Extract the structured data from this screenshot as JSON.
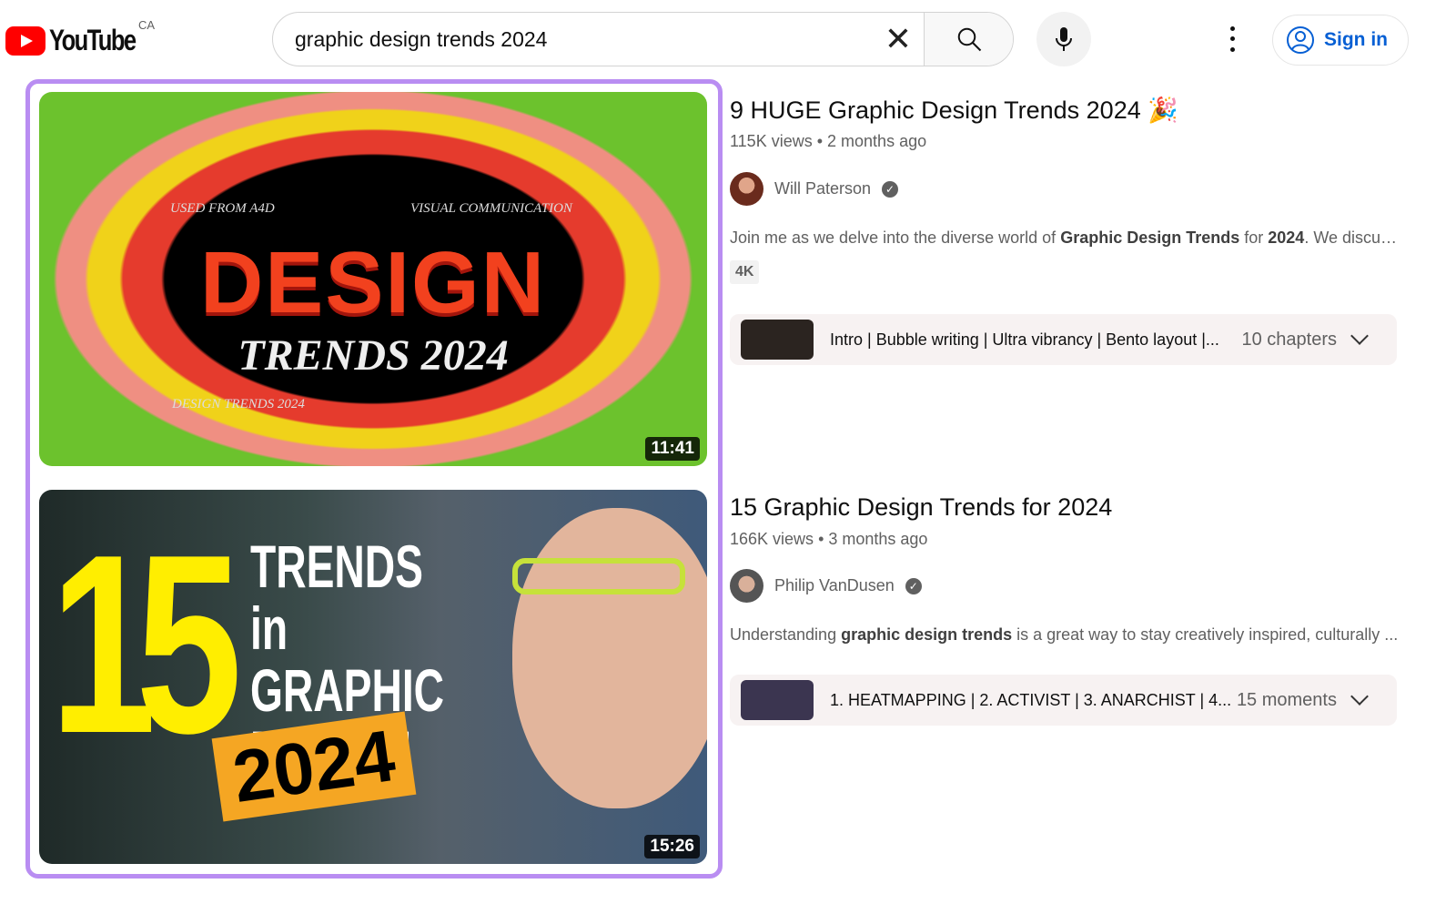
{
  "header": {
    "logo_text": "YouTube",
    "country": "CA",
    "search_value": "graphic design trends 2024",
    "sign_in": "Sign in"
  },
  "colors": {
    "brand": "#ff0000",
    "link": "#065fd4",
    "highlight": "#b98df2"
  },
  "results": [
    {
      "title": "9 HUGE Graphic Design Trends 2024",
      "emoji": "🎉",
      "views": "115K views",
      "age": "2 months ago",
      "channel": "Will Paterson",
      "desc_pre": "Join me as we delve into the diverse world of ",
      "desc_bold": "Graphic Design Trends",
      "desc_mid": " for ",
      "desc_bold2": "2024",
      "desc_post": ". We discuss...",
      "badge": "4K",
      "chapters_text": "Intro | Bubble writing | Ultra vibrancy | Bento layout |...",
      "chapters_count": "10 chapters",
      "duration": "11:41",
      "thumb": {
        "big": "DESIGN",
        "sub": "TRENDS 2024",
        "tl": "USED FROM A4D",
        "tr": "VISUAL COMMUNICATION",
        "bl": "DESIGN TRENDS 2024"
      }
    },
    {
      "title": "15 Graphic Design Trends for 2024",
      "views": "166K views",
      "age": "3 months ago",
      "channel": "Philip VanDusen",
      "desc_pre": "Understanding ",
      "desc_bold": "graphic design trends",
      "desc_post": " is a great way to stay creatively inspired, culturally ...",
      "chapters_text": "1. HEATMAPPING | 2. ACTIVIST | 3. ANARCHIST | 4...",
      "chapters_count": "15 moments",
      "duration": "15:26",
      "thumb": {
        "num": "15",
        "words": "TRENDS in GRAPHIC DESIGN",
        "year": "2024"
      }
    }
  ]
}
